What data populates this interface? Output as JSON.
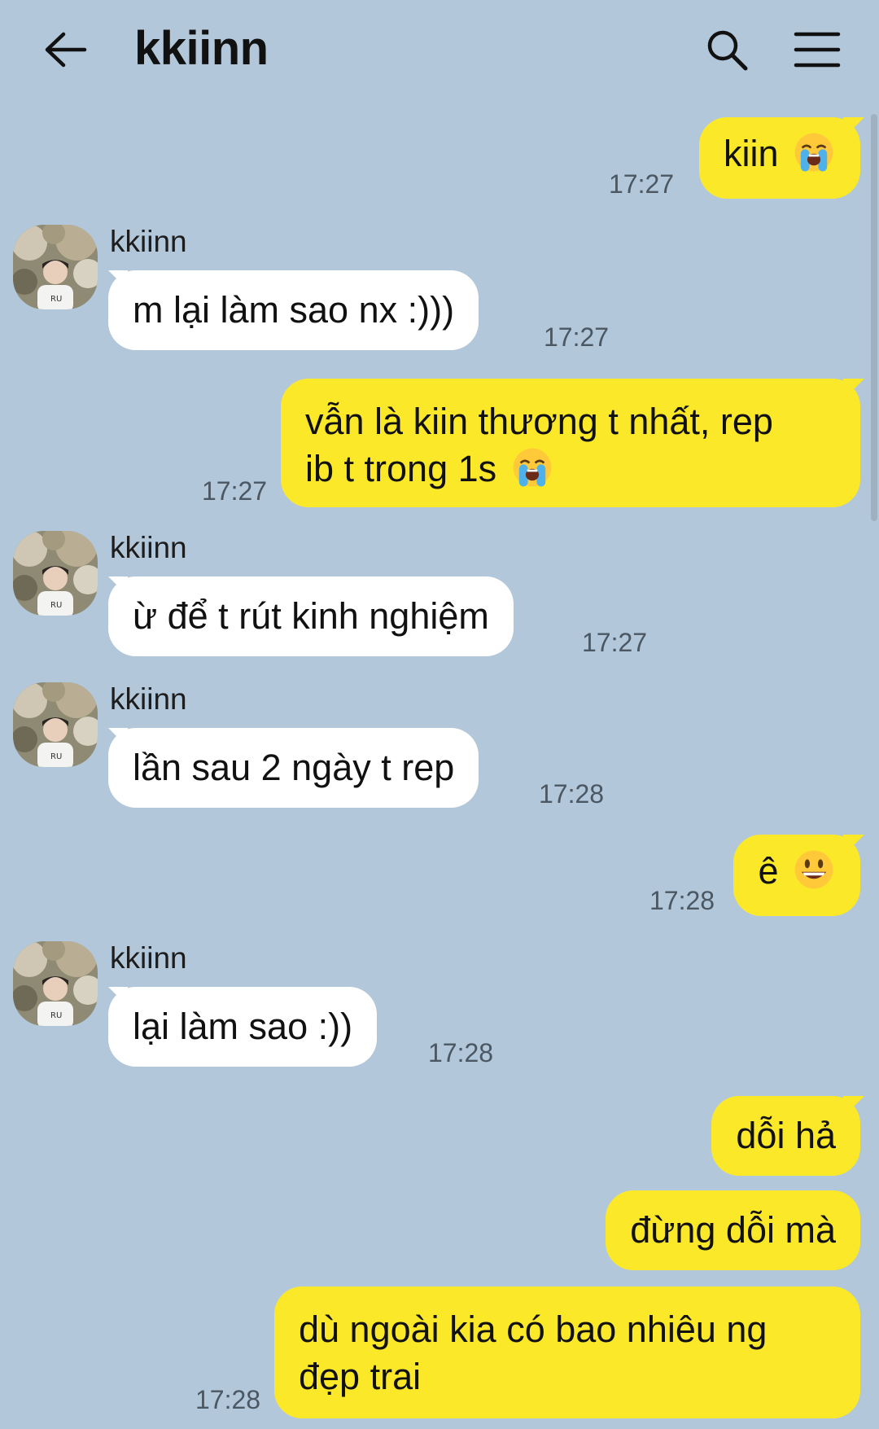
{
  "header": {
    "title": "kkiinn",
    "back_icon": "arrow-left-icon",
    "search_icon": "search-icon",
    "menu_icon": "hamburger-menu-icon"
  },
  "messages": [
    {
      "side": "out",
      "text": "kiin",
      "emoji": "loudly-crying-face",
      "time": "17:27"
    },
    {
      "side": "in",
      "sender": "kkiinn",
      "text": "m lại làm sao nx :)))",
      "time": "17:27"
    },
    {
      "side": "out",
      "text_line1": "vẫn là kiin thương t nhất, rep",
      "text_line2": "ib t trong 1s",
      "emoji": "loudly-crying-face",
      "time": "17:27"
    },
    {
      "side": "in",
      "sender": "kkiinn",
      "text": "ừ để t rút kinh nghiệm",
      "time": "17:27"
    },
    {
      "side": "in",
      "sender": "kkiinn",
      "text": "lần sau 2 ngày t rep",
      "time": "17:28"
    },
    {
      "side": "out",
      "text": "ê",
      "emoji": "grinning-face",
      "time": "17:28"
    },
    {
      "side": "in",
      "sender": "kkiinn",
      "text": "lại làm sao :))",
      "time": "17:28"
    },
    {
      "side": "out",
      "text": "dỗi hả"
    },
    {
      "side": "out",
      "text": "đừng dỗi mà"
    },
    {
      "side": "out",
      "text_line1": "dù ngoài kia có bao nhiêu ng",
      "text_line2": "đẹp trai",
      "time": "17:28"
    }
  ],
  "colors": {
    "background": "#b2c7da",
    "incoming_bubble": "#ffffff",
    "outgoing_bubble": "#fbe829",
    "timestamp": "#4b5762"
  }
}
